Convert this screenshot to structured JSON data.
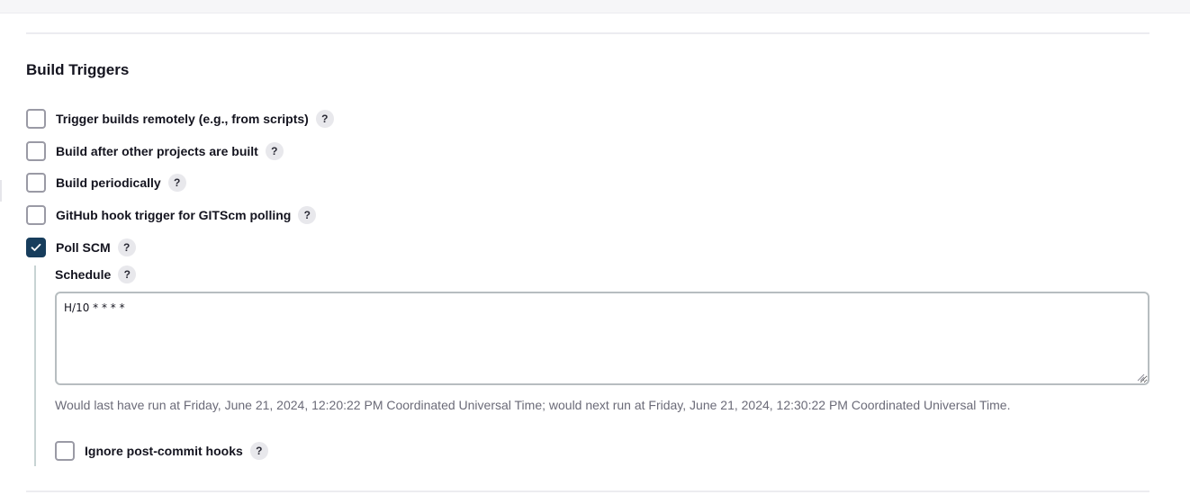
{
  "section": {
    "title": "Build Triggers"
  },
  "triggers": [
    {
      "label": "Trigger builds remotely (e.g., from scripts)",
      "checked": false,
      "help": "?"
    },
    {
      "label": "Build after other projects are built",
      "checked": false,
      "help": "?"
    },
    {
      "label": "Build periodically",
      "checked": false,
      "help": "?"
    },
    {
      "label": "GitHub hook trigger for GITScm polling",
      "checked": false,
      "help": "?"
    },
    {
      "label": "Poll SCM",
      "checked": true,
      "help": "?"
    }
  ],
  "poll_scm": {
    "schedule_label": "Schedule",
    "schedule_help": "?",
    "schedule_value": "H/10 * * * *",
    "run_info": "Would last have run at Friday, June 21, 2024, 12:20:22 PM Coordinated Universal Time; would next run at Friday, June 21, 2024, 12:30:22 PM Coordinated Universal Time.",
    "ignore_hooks": {
      "label": "Ignore post-commit hooks",
      "checked": false,
      "help": "?"
    }
  },
  "colors": {
    "checkbox_checked": "#173d5c",
    "nested_bar": "#c7d3d3",
    "muted_text": "#6b6b78"
  },
  "icons": {
    "check": "checkmark-icon",
    "help": "help-icon",
    "resize": "resize-grip-icon"
  }
}
